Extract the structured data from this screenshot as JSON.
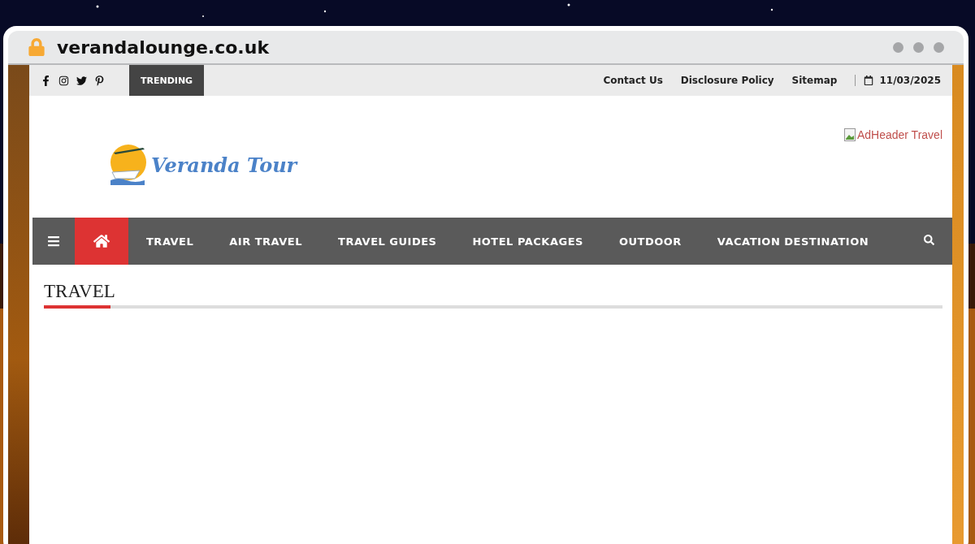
{
  "browser": {
    "url": "verandalounge.co.uk",
    "secure": true
  },
  "top_bar": {
    "trending": "TRENDING",
    "links": [
      "Contact Us",
      "Disclosure Policy",
      "Sitemap"
    ],
    "date": "11/03/2025"
  },
  "header": {
    "logo_text": "Veranda Tour",
    "ad_alt": "AdHeader Travel"
  },
  "nav": {
    "items": [
      {
        "kind": "home",
        "selected": true
      },
      {
        "kind": "link",
        "label": "TRAVEL",
        "selected": false
      },
      {
        "kind": "link",
        "label": "AIR TRAVEL",
        "selected": false
      },
      {
        "kind": "link",
        "label": "TRAVEL GUIDES",
        "selected": false
      },
      {
        "kind": "link",
        "label": "HOTEL PACKAGES",
        "selected": false
      },
      {
        "kind": "link",
        "label": "OUTDOOR",
        "selected": false
      },
      {
        "kind": "link",
        "label": "VACATION DESTINATION",
        "selected": false
      }
    ]
  },
  "section": {
    "title": "TRAVEL"
  }
}
